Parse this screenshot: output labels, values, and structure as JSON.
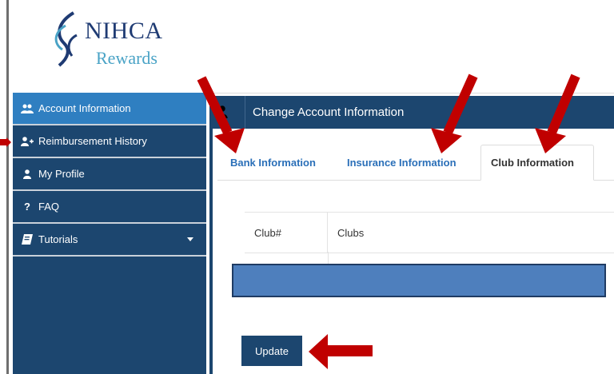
{
  "logo": {
    "name": "NIHCA",
    "sub": "Rewards"
  },
  "sidebar": {
    "items": [
      {
        "label": "Account Information",
        "icon": "users-icon",
        "active": true
      },
      {
        "label": "Reimbursement History",
        "icon": "user-plus-icon",
        "active": false
      },
      {
        "label": "My Profile",
        "icon": "user-icon",
        "active": false
      },
      {
        "label": "FAQ",
        "icon": "question-icon",
        "active": false
      },
      {
        "label": "Tutorials",
        "icon": "book-icon",
        "active": false
      }
    ]
  },
  "panel": {
    "title": "Change Account Information"
  },
  "tabs": [
    {
      "label": "Bank Information"
    },
    {
      "label": "Insurance Information"
    },
    {
      "label": "Club Information"
    }
  ],
  "table": {
    "headers": [
      "Club#",
      "Clubs"
    ]
  },
  "update_label": "Update",
  "colors": {
    "navy": "#1c466f",
    "active_blue": "#2f7fc1",
    "select_blue": "#4e7fbd",
    "link_blue": "#2a6fb8",
    "annotation_red": "#c00000"
  }
}
